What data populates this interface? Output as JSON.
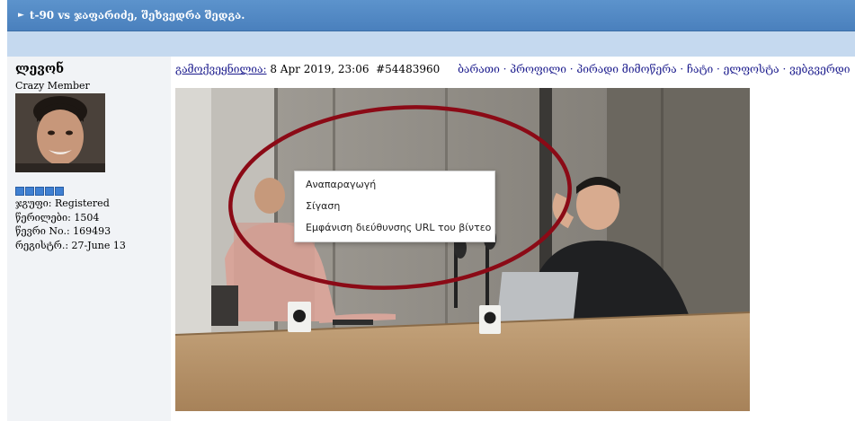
{
  "topic": {
    "title": "t-90 vs ჯაფარიძე, შეხვედრა შედგა."
  },
  "author": {
    "username": "ლევონ",
    "rank": "Crazy Member",
    "rating_pips": 5,
    "stats": [
      "ჯგუფი: Registered",
      "წერილები: 1504",
      "წევრი No.: 169493",
      "რეგისტრ.: 27-June 13"
    ]
  },
  "post": {
    "posted_label": "გამოქვეყნილია:",
    "datetime": "8 Apr 2019, 23:06",
    "post_id": "#54483960",
    "links": "ბარათი · პროფილი · პირადი მიმოწერა · ჩატი · ელფოსტა · ვებგვერდი"
  },
  "context_menu": {
    "items": [
      "Αναπαραγωγή",
      "Σίγαση",
      "Εμφάνιση διεύθυνσης URL του βίντεο"
    ]
  },
  "colors": {
    "topbar": "#4a80bd",
    "subbar": "#c5d9ef",
    "annotation_ring": "#8b0a16",
    "link": "#1a1a8c"
  }
}
